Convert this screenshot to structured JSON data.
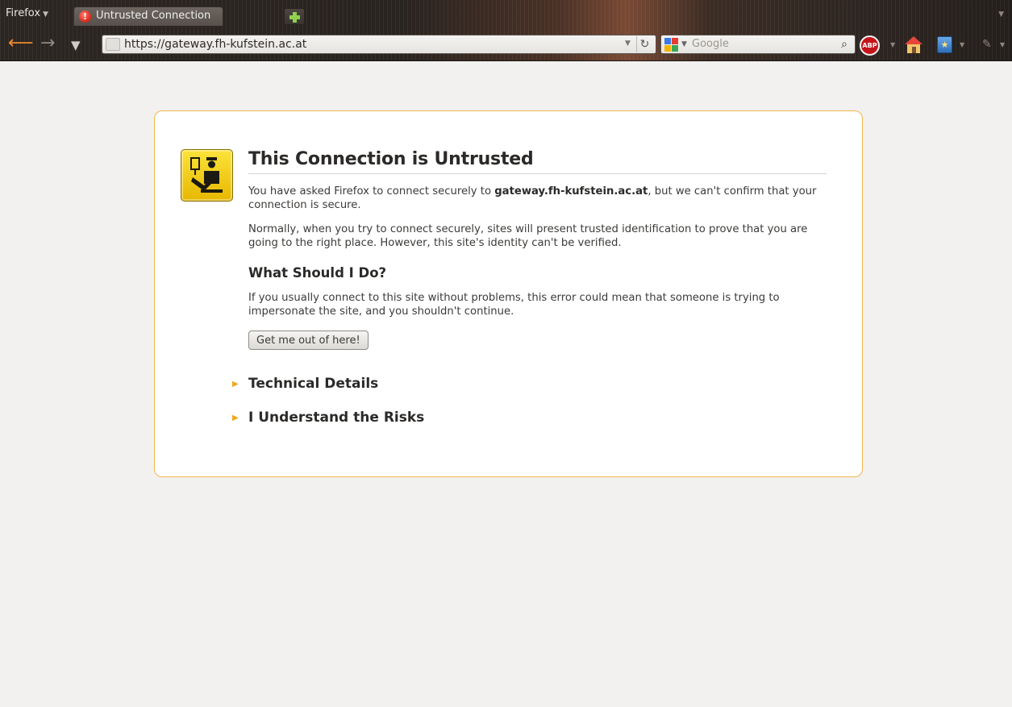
{
  "browser": {
    "menu_label": "Firefox",
    "tab": {
      "title": "Untrusted Connection"
    },
    "url": "https://gateway.fh-kufstein.ac.at",
    "search": {
      "placeholder": "Google"
    },
    "adblock_label": "ABP"
  },
  "page": {
    "title": "This Connection is Untrusted",
    "intro": {
      "before": "You have asked Firefox to connect securely to ",
      "host": "gateway.fh-kufstein.ac.at",
      "after": ", but we can't confirm that your connection is secure."
    },
    "explanation": "Normally, when you try to connect securely, sites will present trusted identification to prove that you are going to the right place. However, this site's identity can't be verified.",
    "what_heading": "What Should I Do?",
    "what_text": "If you usually connect to this site without problems, this error could mean that someone is trying to impersonate the site, and you shouldn't continue.",
    "get_out_button": "Get me out of here!",
    "technical_details": "Technical Details",
    "understand_risks": "I Understand the Risks"
  },
  "colors": {
    "accent_border": "#f0b74a",
    "expander_arrow": "#f2a718",
    "error_icon_bg": "#fbe33b"
  }
}
